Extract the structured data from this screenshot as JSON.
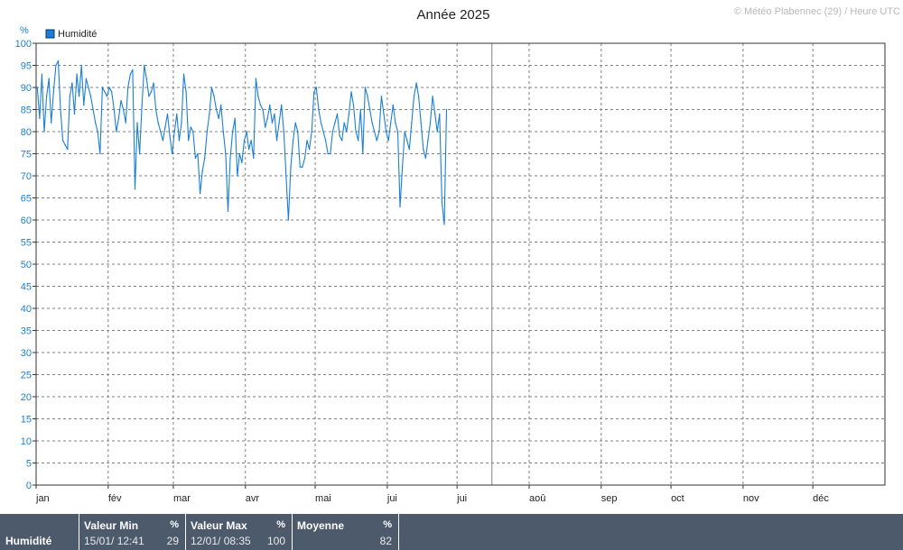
{
  "header": {
    "title": "Année 2025",
    "credit": "© Météo Plabennec (29) / Heure UTC"
  },
  "colors": {
    "series": "#1a7fd4",
    "axis_text": "#1a7fd4",
    "grid": "#808080",
    "stats_bg": "#4d5a6b"
  },
  "chart_data": {
    "type": "line",
    "title": "Année 2025",
    "ylabel": "%",
    "ylim": [
      0,
      100
    ],
    "yticks": [
      0,
      5,
      10,
      15,
      20,
      25,
      30,
      35,
      40,
      45,
      50,
      55,
      60,
      65,
      70,
      75,
      80,
      85,
      90,
      95,
      100
    ],
    "months": [
      "jan",
      "fév",
      "mar",
      "avr",
      "mai",
      "jui",
      "jui",
      "aoû",
      "sep",
      "oct",
      "nov",
      "déc"
    ],
    "month_starts": [
      0,
      31,
      59,
      90,
      120,
      151,
      181,
      212,
      243,
      273,
      304,
      334
    ],
    "days_in_year": 365,
    "current_day": 196,
    "legend": {
      "label": "Humidité",
      "position": "top-left"
    },
    "grid": true,
    "series": [
      {
        "name": "Humidité",
        "values": [
          90,
          83,
          93,
          80,
          88,
          92,
          82,
          89,
          95,
          96,
          85,
          78,
          77,
          76,
          88,
          91,
          84,
          93,
          88,
          95,
          86,
          92,
          90,
          88,
          85,
          82,
          80,
          75,
          90,
          89,
          88,
          90,
          89,
          85,
          80,
          83,
          87,
          85,
          82,
          90,
          93,
          94,
          67,
          82,
          75,
          86,
          95,
          92,
          88,
          89,
          91,
          85,
          82,
          80,
          78,
          81,
          84,
          79,
          75,
          80,
          84,
          78,
          82,
          93,
          89,
          78,
          81,
          80,
          74,
          75,
          66,
          71,
          74,
          80,
          84,
          90,
          88,
          85,
          83,
          86,
          80,
          75,
          62,
          74,
          80,
          83,
          70,
          75,
          73,
          78,
          80,
          76,
          78,
          74,
          92,
          88,
          86,
          85,
          81,
          83,
          86,
          82,
          84,
          78,
          82,
          86,
          80,
          70,
          60,
          72,
          78,
          82,
          80,
          72,
          72,
          74,
          78,
          76,
          80,
          89,
          90,
          85,
          82,
          80,
          78,
          75,
          75,
          80,
          82,
          84,
          79,
          78,
          82,
          80,
          84,
          89,
          86,
          80,
          78,
          85,
          75,
          90,
          88,
          85,
          82,
          80,
          78,
          80,
          88,
          84,
          80,
          78,
          82,
          86,
          82,
          80,
          63,
          72,
          80,
          78,
          76,
          82,
          88,
          91,
          88,
          82,
          76,
          74,
          78,
          82,
          88,
          84,
          80,
          84,
          64,
          59,
          85
        ]
      }
    ]
  },
  "stats": {
    "row_label": "Humidité",
    "min": {
      "label": "Valeur Min",
      "unit": "%",
      "date": "15/01/  12:41",
      "value": "29"
    },
    "max": {
      "label": "Valeur Max",
      "unit": "%",
      "date": "12/01/  08:35",
      "value": "100"
    },
    "avg": {
      "label": "Moyenne",
      "unit": "%",
      "value": "82"
    }
  }
}
